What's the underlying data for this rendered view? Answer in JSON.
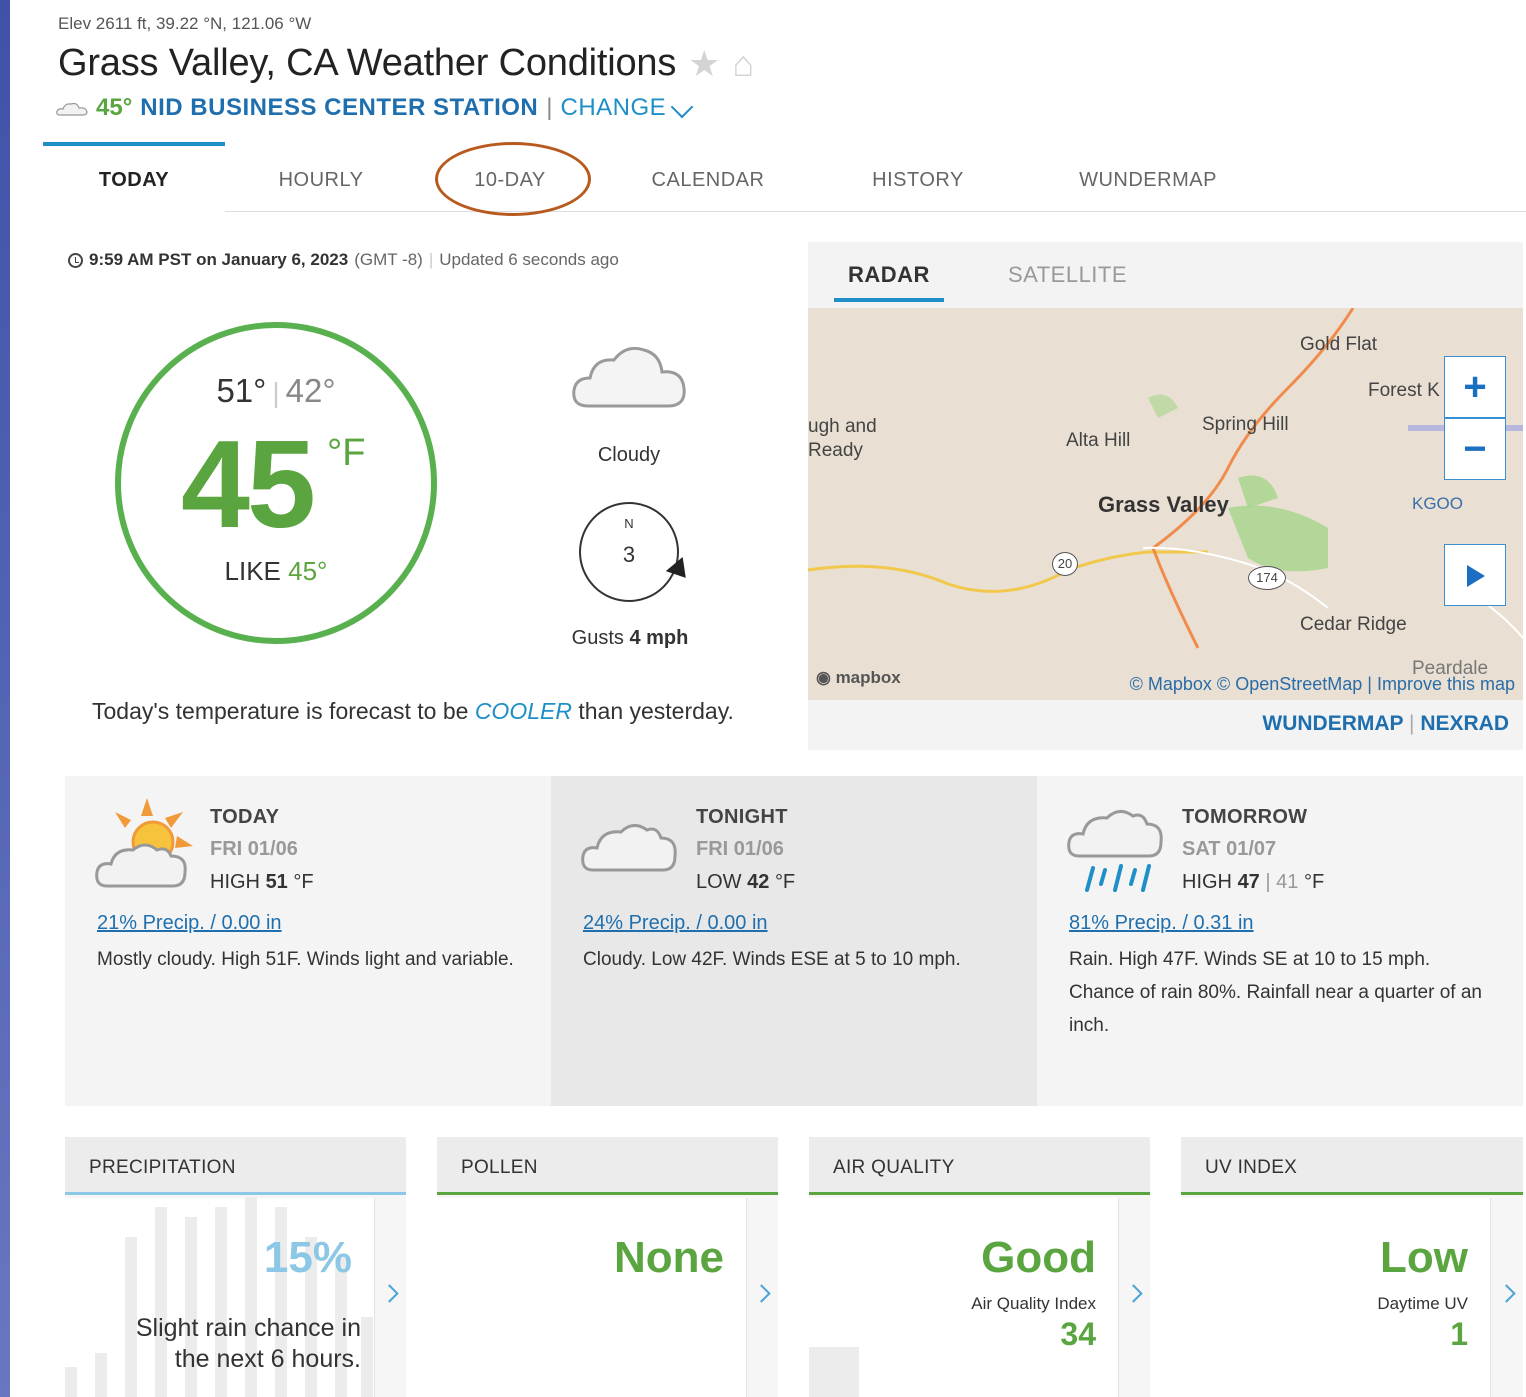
{
  "header": {
    "elevation": "Elev 2611 ft, 39.22 °N, 121.06 °W",
    "title": "Grass Valley, CA Weather Conditions",
    "star_icon": "star-icon",
    "home_icon": "home-icon",
    "station_temp": "45°",
    "station_name": "NID BUSINESS CENTER STATION",
    "separator": "|",
    "change_label": "CHANGE"
  },
  "tabs": [
    {
      "label": "TODAY",
      "active": true
    },
    {
      "label": "HOURLY"
    },
    {
      "label": "10-DAY",
      "circled": true
    },
    {
      "label": "CALENDAR"
    },
    {
      "label": "HISTORY"
    },
    {
      "label": "WUNDERMAP"
    }
  ],
  "current": {
    "time": "9:59 AM PST on January 6, 2023",
    "tz": "(GMT -8)",
    "updated": "Updated 6 seconds ago",
    "high": "51°",
    "low": "42°",
    "temp": "45",
    "unit": "°F",
    "feels_label": "LIKE",
    "feels_value": "45°",
    "condition": "Cloudy",
    "wind_dir": "N",
    "wind_speed": "3",
    "gusts_label": "Gusts",
    "gusts_value": "4 mph",
    "forecast_pre": "Today's temperature is forecast to be",
    "forecast_word": "COOLER",
    "forecast_post": "than yesterday."
  },
  "radar": {
    "tab_radar": "RADAR",
    "tab_satellite": "SATELLITE",
    "labels": {
      "gold_flat": "Gold Flat",
      "forest": "Forest K",
      "spring_hill": "Spring Hill",
      "alta_hill": "Alta Hill",
      "rough1": "ugh and",
      "rough2": "Ready",
      "grass_valley": "Grass Valley",
      "kgoo": "KGOO",
      "cedar_ridge": "Cedar Ridge",
      "peardale": "Peardale",
      "route20": "20",
      "route174": "174"
    },
    "zoom_in": "+",
    "zoom_out": "−",
    "mapbox": "mapbox",
    "attribution": "© Mapbox © OpenStreetMap | Improve this map",
    "link_wundermap": "WUNDERMAP",
    "link_sep": "|",
    "link_nexrad": "NEXRAD"
  },
  "forecast": [
    {
      "when": "TODAY",
      "date": "FRI 01/06",
      "kind": "HIGH",
      "value": "51",
      "unit": "°F",
      "precip": "21% Precip. / 0.00 in",
      "desc": "Mostly cloudy. High 51F. Winds light and variable.",
      "icon": "partly-cloudy-sun-icon"
    },
    {
      "when": "TONIGHT",
      "date": "FRI 01/06",
      "kind": "LOW",
      "value": "42",
      "unit": "°F",
      "precip": "24% Precip. / 0.00 in",
      "desc": "Cloudy. Low 42F. Winds ESE at 5 to 10 mph.",
      "icon": "cloud-icon"
    },
    {
      "when": "TOMORROW",
      "date": "SAT 01/07",
      "kind": "HIGH",
      "value": "47",
      "low": "41",
      "unit": "°F",
      "precip": "81% Precip. / 0.31 in",
      "desc": "Rain. High 47F. Winds SE at 10 to 15 mph. Chance of rain 80%. Rainfall near a quarter of an inch.",
      "icon": "rain-icon"
    }
  ],
  "tiles": {
    "precipitation": {
      "title": "PRECIPITATION",
      "value": "15%",
      "note": "Slight rain chance in the next 6 hours."
    },
    "pollen": {
      "title": "POLLEN",
      "value": "None"
    },
    "air_quality": {
      "title": "AIR QUALITY",
      "value": "Good",
      "sub": "Air Quality Index",
      "num": "34"
    },
    "uv": {
      "title": "UV INDEX",
      "value": "Low",
      "sub": "Daytime UV",
      "num": "1"
    }
  },
  "colors": {
    "accent": "#1f8fc7",
    "green": "#5aa53f",
    "annotation": "#b85a1e"
  }
}
